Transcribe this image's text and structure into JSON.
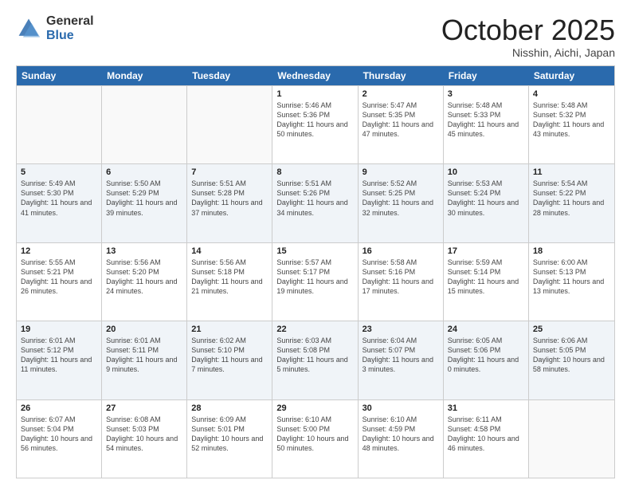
{
  "logo": {
    "general": "General",
    "blue": "Blue"
  },
  "title": "October 2025",
  "subtitle": "Nisshin, Aichi, Japan",
  "header": {
    "days": [
      "Sunday",
      "Monday",
      "Tuesday",
      "Wednesday",
      "Thursday",
      "Friday",
      "Saturday"
    ]
  },
  "rows": [
    {
      "alt": false,
      "cells": [
        {
          "day": "",
          "info": ""
        },
        {
          "day": "",
          "info": ""
        },
        {
          "day": "",
          "info": ""
        },
        {
          "day": "1",
          "info": "Sunrise: 5:46 AM\nSunset: 5:36 PM\nDaylight: 11 hours and 50 minutes."
        },
        {
          "day": "2",
          "info": "Sunrise: 5:47 AM\nSunset: 5:35 PM\nDaylight: 11 hours and 47 minutes."
        },
        {
          "day": "3",
          "info": "Sunrise: 5:48 AM\nSunset: 5:33 PM\nDaylight: 11 hours and 45 minutes."
        },
        {
          "day": "4",
          "info": "Sunrise: 5:48 AM\nSunset: 5:32 PM\nDaylight: 11 hours and 43 minutes."
        }
      ]
    },
    {
      "alt": true,
      "cells": [
        {
          "day": "5",
          "info": "Sunrise: 5:49 AM\nSunset: 5:30 PM\nDaylight: 11 hours and 41 minutes."
        },
        {
          "day": "6",
          "info": "Sunrise: 5:50 AM\nSunset: 5:29 PM\nDaylight: 11 hours and 39 minutes."
        },
        {
          "day": "7",
          "info": "Sunrise: 5:51 AM\nSunset: 5:28 PM\nDaylight: 11 hours and 37 minutes."
        },
        {
          "day": "8",
          "info": "Sunrise: 5:51 AM\nSunset: 5:26 PM\nDaylight: 11 hours and 34 minutes."
        },
        {
          "day": "9",
          "info": "Sunrise: 5:52 AM\nSunset: 5:25 PM\nDaylight: 11 hours and 32 minutes."
        },
        {
          "day": "10",
          "info": "Sunrise: 5:53 AM\nSunset: 5:24 PM\nDaylight: 11 hours and 30 minutes."
        },
        {
          "day": "11",
          "info": "Sunrise: 5:54 AM\nSunset: 5:22 PM\nDaylight: 11 hours and 28 minutes."
        }
      ]
    },
    {
      "alt": false,
      "cells": [
        {
          "day": "12",
          "info": "Sunrise: 5:55 AM\nSunset: 5:21 PM\nDaylight: 11 hours and 26 minutes."
        },
        {
          "day": "13",
          "info": "Sunrise: 5:56 AM\nSunset: 5:20 PM\nDaylight: 11 hours and 24 minutes."
        },
        {
          "day": "14",
          "info": "Sunrise: 5:56 AM\nSunset: 5:18 PM\nDaylight: 11 hours and 21 minutes."
        },
        {
          "day": "15",
          "info": "Sunrise: 5:57 AM\nSunset: 5:17 PM\nDaylight: 11 hours and 19 minutes."
        },
        {
          "day": "16",
          "info": "Sunrise: 5:58 AM\nSunset: 5:16 PM\nDaylight: 11 hours and 17 minutes."
        },
        {
          "day": "17",
          "info": "Sunrise: 5:59 AM\nSunset: 5:14 PM\nDaylight: 11 hours and 15 minutes."
        },
        {
          "day": "18",
          "info": "Sunrise: 6:00 AM\nSunset: 5:13 PM\nDaylight: 11 hours and 13 minutes."
        }
      ]
    },
    {
      "alt": true,
      "cells": [
        {
          "day": "19",
          "info": "Sunrise: 6:01 AM\nSunset: 5:12 PM\nDaylight: 11 hours and 11 minutes."
        },
        {
          "day": "20",
          "info": "Sunrise: 6:01 AM\nSunset: 5:11 PM\nDaylight: 11 hours and 9 minutes."
        },
        {
          "day": "21",
          "info": "Sunrise: 6:02 AM\nSunset: 5:10 PM\nDaylight: 11 hours and 7 minutes."
        },
        {
          "day": "22",
          "info": "Sunrise: 6:03 AM\nSunset: 5:08 PM\nDaylight: 11 hours and 5 minutes."
        },
        {
          "day": "23",
          "info": "Sunrise: 6:04 AM\nSunset: 5:07 PM\nDaylight: 11 hours and 3 minutes."
        },
        {
          "day": "24",
          "info": "Sunrise: 6:05 AM\nSunset: 5:06 PM\nDaylight: 11 hours and 0 minutes."
        },
        {
          "day": "25",
          "info": "Sunrise: 6:06 AM\nSunset: 5:05 PM\nDaylight: 10 hours and 58 minutes."
        }
      ]
    },
    {
      "alt": false,
      "cells": [
        {
          "day": "26",
          "info": "Sunrise: 6:07 AM\nSunset: 5:04 PM\nDaylight: 10 hours and 56 minutes."
        },
        {
          "day": "27",
          "info": "Sunrise: 6:08 AM\nSunset: 5:03 PM\nDaylight: 10 hours and 54 minutes."
        },
        {
          "day": "28",
          "info": "Sunrise: 6:09 AM\nSunset: 5:01 PM\nDaylight: 10 hours and 52 minutes."
        },
        {
          "day": "29",
          "info": "Sunrise: 6:10 AM\nSunset: 5:00 PM\nDaylight: 10 hours and 50 minutes."
        },
        {
          "day": "30",
          "info": "Sunrise: 6:10 AM\nSunset: 4:59 PM\nDaylight: 10 hours and 48 minutes."
        },
        {
          "day": "31",
          "info": "Sunrise: 6:11 AM\nSunset: 4:58 PM\nDaylight: 10 hours and 46 minutes."
        },
        {
          "day": "",
          "info": ""
        }
      ]
    }
  ]
}
